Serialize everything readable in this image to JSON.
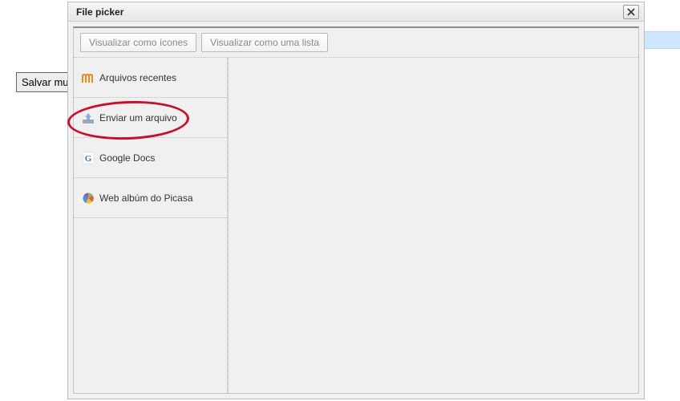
{
  "background": {
    "save_button_label": "Salvar muda"
  },
  "dialog": {
    "title": "File picker",
    "toolbar": {
      "view_icons_label": "Visualizar como ícones",
      "view_list_label": "Visualizar como uma lista"
    },
    "repositories": [
      {
        "label": "Arquivos recentes",
        "icon": "moodle-icon"
      },
      {
        "label": "Enviar um arquivo",
        "icon": "upload-icon",
        "highlighted": true
      },
      {
        "label": "Google Docs",
        "icon": "google-icon"
      },
      {
        "label": "Web albúm do Picasa",
        "icon": "picasa-icon"
      }
    ]
  }
}
